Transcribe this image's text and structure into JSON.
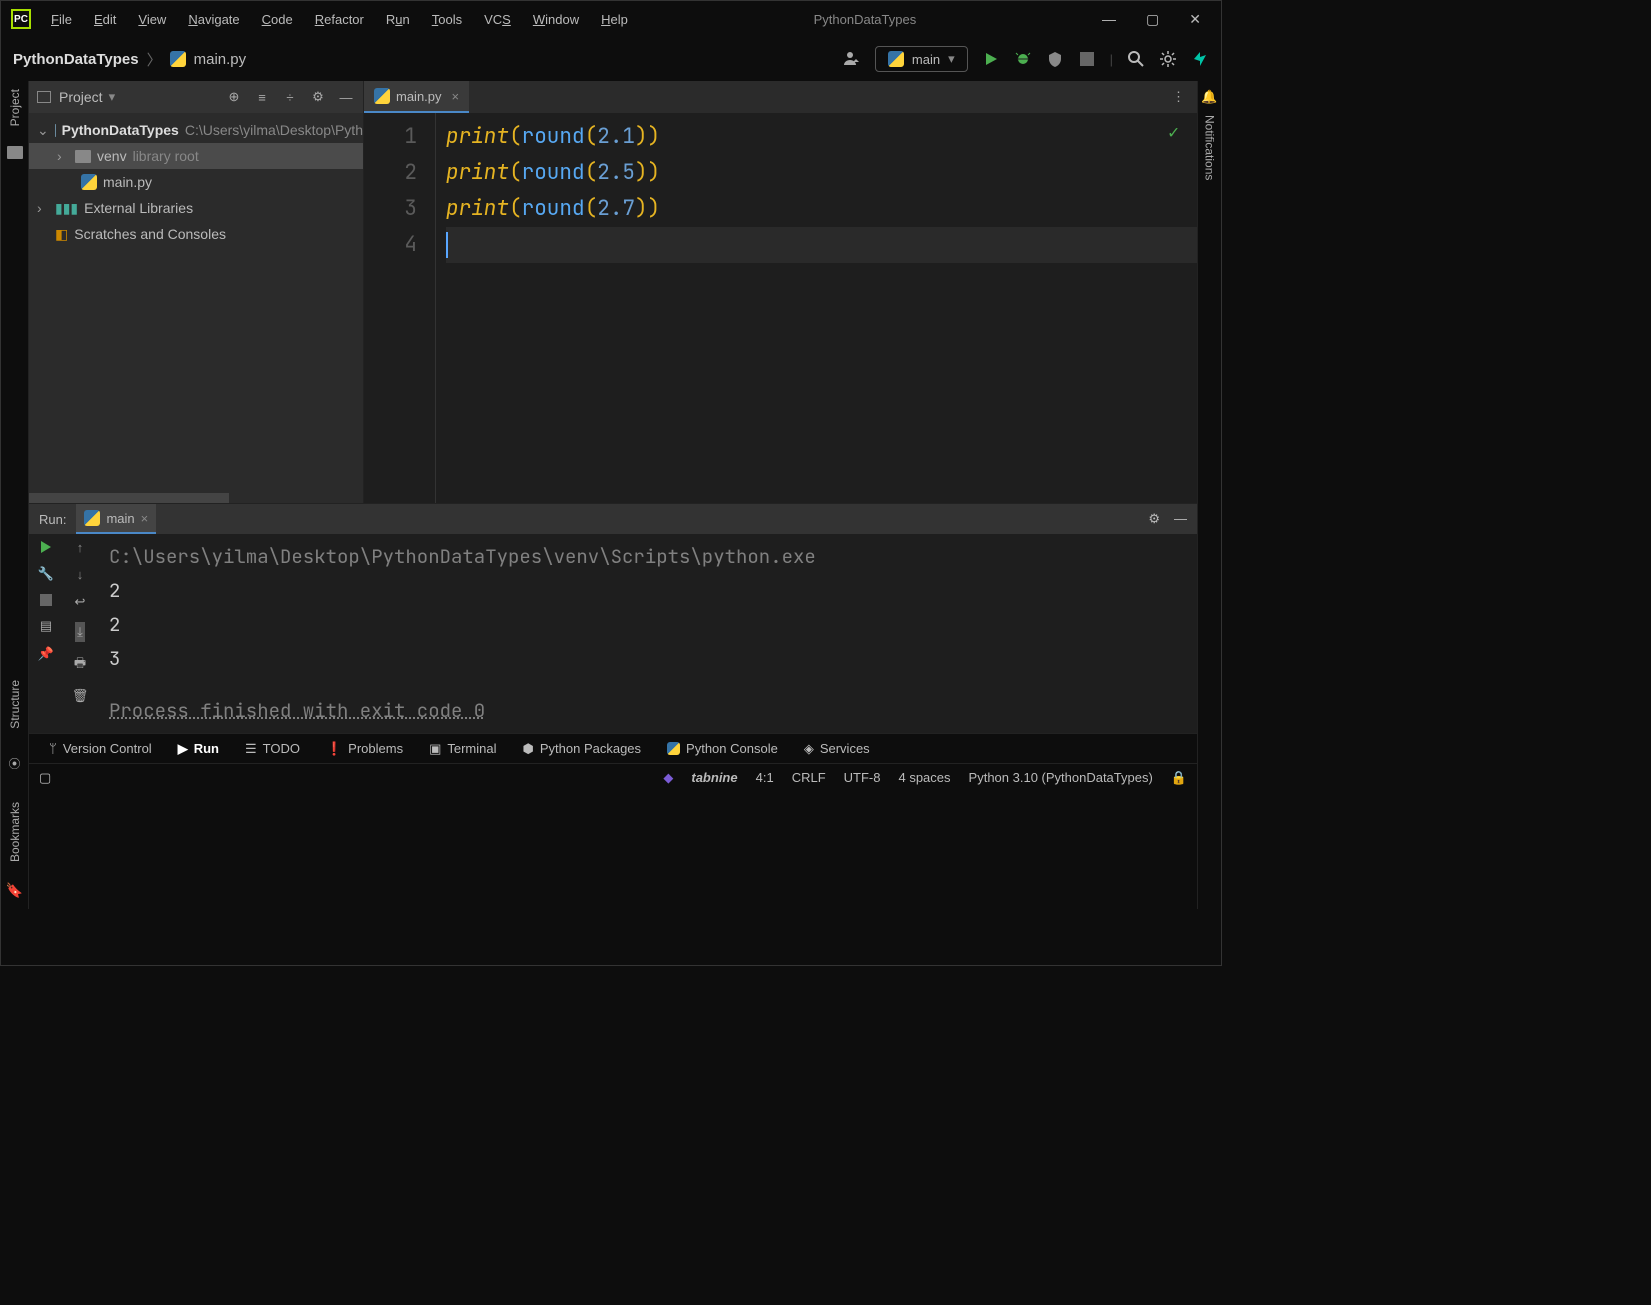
{
  "window": {
    "title": "PythonDataTypes",
    "controls": {
      "min": "—",
      "max": "▢",
      "close": "✕"
    }
  },
  "menu": {
    "file": "File",
    "edit": "Edit",
    "view": "View",
    "navigate": "Navigate",
    "code": "Code",
    "refactor": "Refactor",
    "run": "Run",
    "tools": "Tools",
    "vcs": "VCS",
    "window": "Window",
    "help": "Help"
  },
  "breadcrumb": {
    "project": "PythonDataTypes",
    "file": "main.py"
  },
  "run_config": {
    "name": "main"
  },
  "project_panel": {
    "title": "Project",
    "root": "PythonDataTypes",
    "root_path": "C:\\Users\\yilma\\Desktop\\Pyth",
    "venv": "venv",
    "venv_hint": "library root",
    "file": "main.py",
    "external": "External Libraries",
    "scratches": "Scratches and Consoles"
  },
  "editor": {
    "tab": "main.py",
    "lines": [
      "1",
      "2",
      "3",
      "4"
    ],
    "code": [
      {
        "fn": "print",
        "inner_fn": "round",
        "num": "2.1"
      },
      {
        "fn": "print",
        "inner_fn": "round",
        "num": "2.5"
      },
      {
        "fn": "print",
        "inner_fn": "round",
        "num": "2.7"
      }
    ]
  },
  "run_panel": {
    "label": "Run:",
    "tab": "main",
    "output": {
      "command": "C:\\Users\\yilma\\Desktop\\PythonDataTypes\\venv\\Scripts\\python.exe",
      "lines": [
        "2",
        "2",
        "3"
      ],
      "exit": "Process finished with exit code 0"
    }
  },
  "left_strip": {
    "project": "Project",
    "structure": "Structure",
    "bookmarks": "Bookmarks"
  },
  "right_strip": {
    "notifications": "Notifications"
  },
  "bottom_toolbar": {
    "version_control": "Version Control",
    "run": "Run",
    "todo": "TODO",
    "problems": "Problems",
    "terminal": "Terminal",
    "packages": "Python Packages",
    "console": "Python Console",
    "services": "Services"
  },
  "status": {
    "tabnine": "tabnine",
    "cursor": "4:1",
    "eol": "CRLF",
    "encoding": "UTF-8",
    "indent": "4 spaces",
    "interpreter": "Python 3.10 (PythonDataTypes)"
  }
}
